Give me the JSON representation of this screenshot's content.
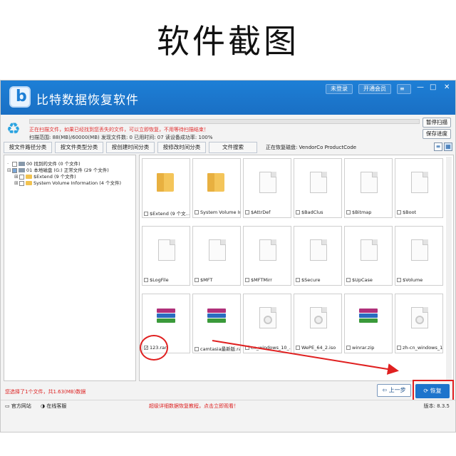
{
  "headline": "软件截图",
  "app": {
    "title": "比特数据恢复软件",
    "top_buttons": [
      "未登录",
      "开通会员",
      "登录"
    ],
    "window_controls": [
      "—",
      "□",
      "✕"
    ]
  },
  "scan": {
    "status": "正在扫描文件，如果已经找到您丢失的文件，可以立即恢复，不用等待扫描结束！",
    "info": "扫描范围: 88(MB)/60000(MB)   发现文件数: 0   已用时间: 07   读设备成功率: 100%",
    "pause_label": "暂停扫描",
    "save_label": "保存进度"
  },
  "tabs": [
    "按文件路径分类",
    "按文件类型分类",
    "按创建时间分类",
    "按修改时间分类",
    "文件搜索"
  ],
  "drive_label": "正在恢复磁盘: VendorCo ProductCode",
  "tree": [
    {
      "label": "00 找到的文件  (0 个文件)",
      "level": 0
    },
    {
      "label": "01 本地磁盘 (G:) 正常文件  (29 个文件)",
      "level": 0
    },
    {
      "label": "$Extend  (9 个文件)",
      "level": 1
    },
    {
      "label": "System Volume Information   (4 个文件)",
      "level": 1
    }
  ],
  "files": [
    {
      "name": "$Extend (9 个文...",
      "type": "folder",
      "checked": false
    },
    {
      "name": "System Volume In...",
      "type": "folder",
      "checked": false
    },
    {
      "name": "$AttrDef",
      "type": "file",
      "checked": false
    },
    {
      "name": "$BadClus",
      "type": "file",
      "checked": false
    },
    {
      "name": "$Bitmap",
      "type": "file",
      "checked": false
    },
    {
      "name": "$Boot",
      "type": "file",
      "checked": false
    },
    {
      "name": "$LogFile",
      "type": "file",
      "checked": false
    },
    {
      "name": "$MFT",
      "type": "file",
      "checked": false
    },
    {
      "name": "$MFTMirr",
      "type": "file",
      "checked": false
    },
    {
      "name": "$Secure",
      "type": "file",
      "checked": false
    },
    {
      "name": "$UpCase",
      "type": "file",
      "checked": false
    },
    {
      "name": "$Volume",
      "type": "file",
      "checked": false
    },
    {
      "name": "123.rar",
      "type": "rar",
      "checked": true
    },
    {
      "name": "camtasia最新版.rar",
      "type": "rar",
      "checked": false
    },
    {
      "name": "cn_windows_10_...",
      "type": "iso",
      "checked": false
    },
    {
      "name": "WePE_64_2.iso",
      "type": "iso",
      "checked": false
    },
    {
      "name": "winrar.zip",
      "type": "rar",
      "checked": false
    },
    {
      "name": "zh-cn_windows_1...",
      "type": "iso",
      "checked": false
    }
  ],
  "selection_status": "您选择了1个文件，共1.63(MB)数据",
  "buttons": {
    "prev": "上一步",
    "recover": "恢复"
  },
  "footer": {
    "site": "官方网站",
    "support": "在线客服",
    "promo": "超级详细数据恢复教程，点击立即观看！",
    "version": "版本: 8.3.5"
  },
  "colors": {
    "accent": "#1d74cc",
    "alert": "#e02020",
    "folder": "#f4c55a"
  }
}
